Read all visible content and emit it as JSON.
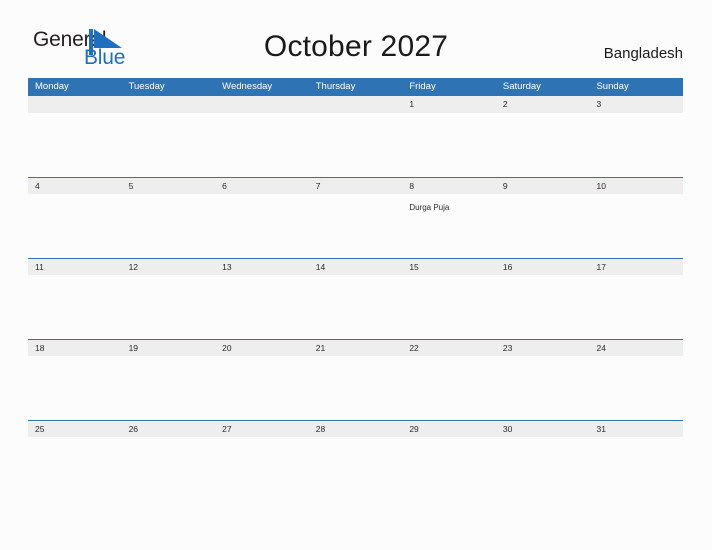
{
  "brand": {
    "name_part1": "General",
    "name_part2": "Blue",
    "color_primary": "#1f6fc0",
    "color_text": "#231f20",
    "flag_icon": "triangle-flag-icon"
  },
  "header": {
    "title": "October 2027",
    "country": "Bangladesh"
  },
  "theme": {
    "header_bar": "#2e74b5",
    "date_band": "#eeeeee",
    "page_background": "#fcfcfc",
    "text": "#2b2b2b"
  },
  "calendar": {
    "weekdays": [
      "Monday",
      "Tuesday",
      "Wednesday",
      "Thursday",
      "Friday",
      "Saturday",
      "Sunday"
    ],
    "weeks": [
      {
        "dates": [
          "",
          "",
          "",
          "",
          "1",
          "2",
          "3"
        ],
        "events": [
          "",
          "",
          "",
          "",
          "",
          "",
          ""
        ]
      },
      {
        "dates": [
          "4",
          "5",
          "6",
          "7",
          "8",
          "9",
          "10"
        ],
        "events": [
          "",
          "",
          "",
          "",
          "Durga Puja",
          "",
          ""
        ]
      },
      {
        "dates": [
          "11",
          "12",
          "13",
          "14",
          "15",
          "16",
          "17"
        ],
        "events": [
          "",
          "",
          "",
          "",
          "",
          "",
          ""
        ]
      },
      {
        "dates": [
          "18",
          "19",
          "20",
          "21",
          "22",
          "23",
          "24"
        ],
        "events": [
          "",
          "",
          "",
          "",
          "",
          "",
          ""
        ]
      },
      {
        "dates": [
          "25",
          "26",
          "27",
          "28",
          "29",
          "30",
          "31"
        ],
        "events": [
          "",
          "",
          "",
          "",
          "",
          "",
          ""
        ]
      }
    ]
  }
}
